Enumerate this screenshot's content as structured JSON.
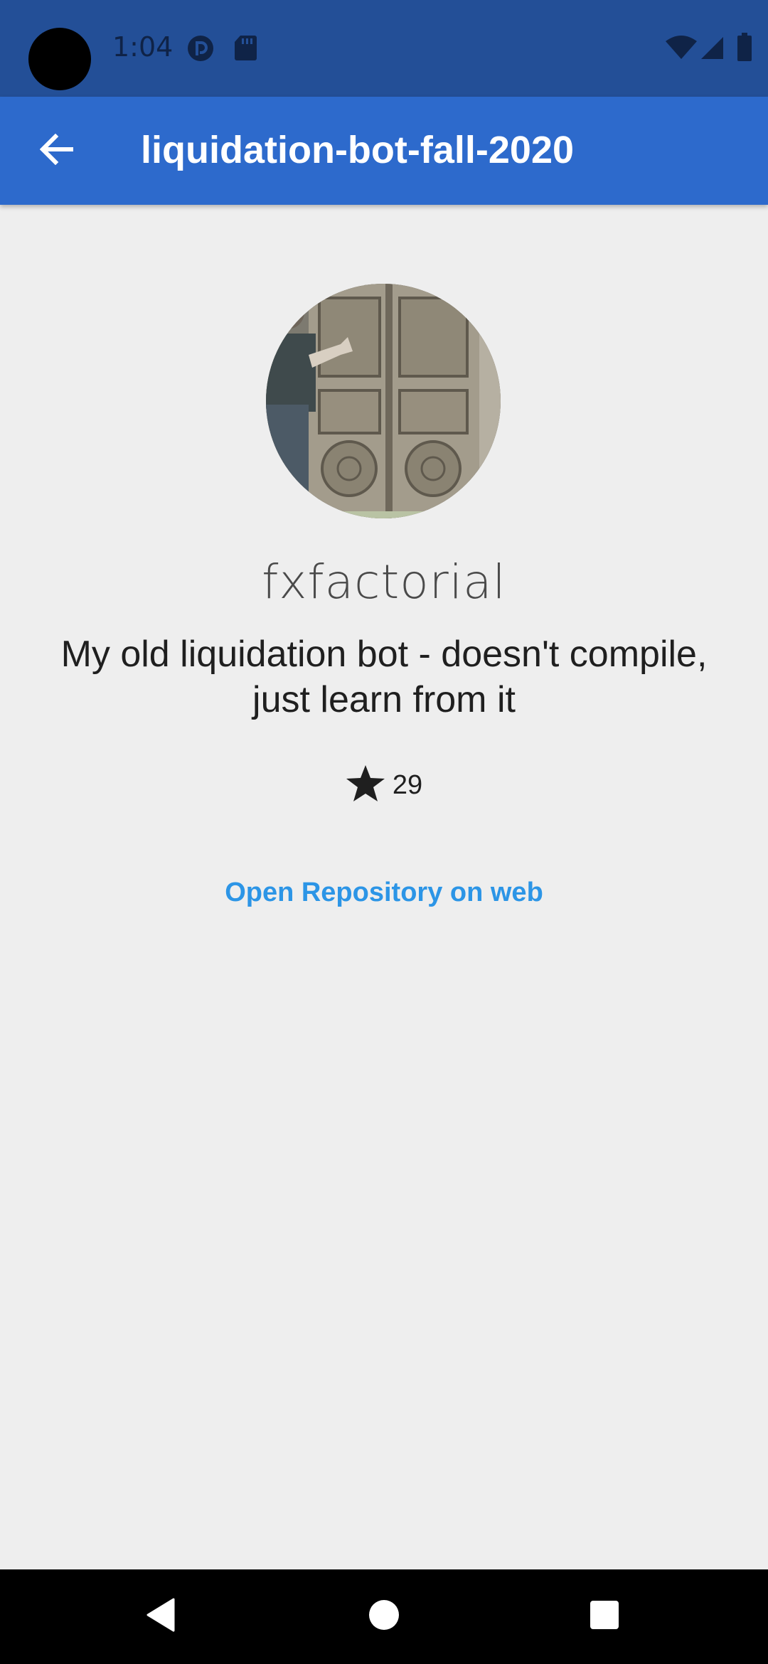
{
  "status_bar": {
    "time": "1:04",
    "icons": [
      "pocket-casts-icon",
      "sd-card-icon",
      "wifi-icon",
      "cell-signal-icon",
      "battery-icon"
    ],
    "background": "#234f97"
  },
  "app_bar": {
    "title": "liquidation-bot-fall-2020",
    "back_icon": "arrow-left-icon",
    "background": "#2d6acc"
  },
  "repository": {
    "owner_avatar": "owner-avatar-image",
    "owner": "fxfactorial",
    "description": "My old liquidation bot - doesn't compile, just learn from it",
    "star_icon": "star-icon",
    "stars": "29",
    "open_link_label": "Open Repository on web",
    "link_color": "#2c95e6"
  },
  "nav_bar": {
    "back_icon": "triangle-back-icon",
    "home_icon": "circle-home-icon",
    "recents_icon": "square-recents-icon"
  }
}
